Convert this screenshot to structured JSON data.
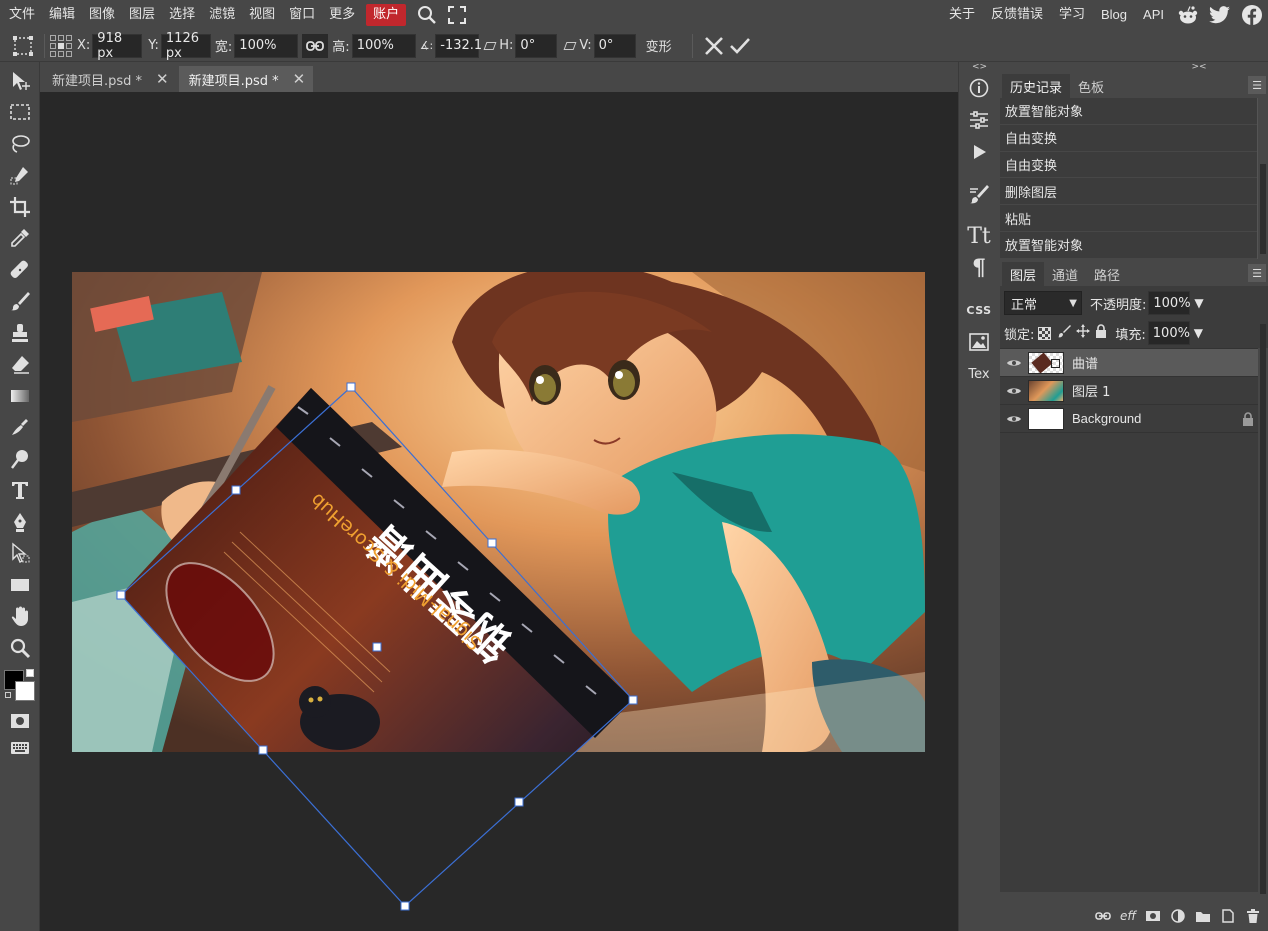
{
  "menubar": {
    "items": [
      "文件",
      "编辑",
      "图像",
      "图层",
      "选择",
      "滤镜",
      "视图",
      "窗口",
      "更多"
    ],
    "account": "账户",
    "right_items": [
      "关于",
      "反馈错误",
      "学习",
      "Blog",
      "API"
    ]
  },
  "options": {
    "x_label": "X:",
    "x_value": "918 px",
    "y_label": "Y:",
    "y_value": "1126 px",
    "w_label": "宽:",
    "w_value": "100%",
    "h_label": "高:",
    "h_value": "100%",
    "angle_label": "∡:",
    "angle_value": "-132.1",
    "skew_h_label": "H:",
    "skew_h_value": "0°",
    "skew_v_label": "V:",
    "skew_v_value": "0°",
    "warp_label": "变形"
  },
  "tabs": [
    {
      "label": "新建项目.psd *",
      "active": false
    },
    {
      "label": "新建项目.psd *",
      "active": true
    }
  ],
  "strip": {
    "css_label": "CSS",
    "tex_label": "Tex"
  },
  "history_panel": {
    "tabs": [
      "历史记录",
      "色板"
    ],
    "items": [
      "放置智能对象",
      "自由变换",
      "自由变换",
      "删除图层",
      "粘贴",
      "放置智能对象"
    ]
  },
  "layers_panel": {
    "tabs": [
      "图层",
      "通道",
      "路径"
    ],
    "blend_mode": "正常",
    "opacity_label": "不透明度:",
    "opacity_value": "100%",
    "lock_label": "锁定:",
    "fill_label": "填充:",
    "fill_value": "100%",
    "layers": [
      {
        "name": "曲谱",
        "selected": true
      },
      {
        "name": "图层 1",
        "selected": false
      },
      {
        "name": "Background",
        "selected": false,
        "locked": true
      }
    ],
    "bottom_eff": "eff"
  },
  "poster": {
    "title": "钢琴曲谱",
    "subtitle": "Signal-Midi & ScoreHub"
  },
  "colors": {
    "accent_red": "#c1272d",
    "transform_box": "#3b6fd4",
    "shirt_teal": "#1f9e94"
  }
}
